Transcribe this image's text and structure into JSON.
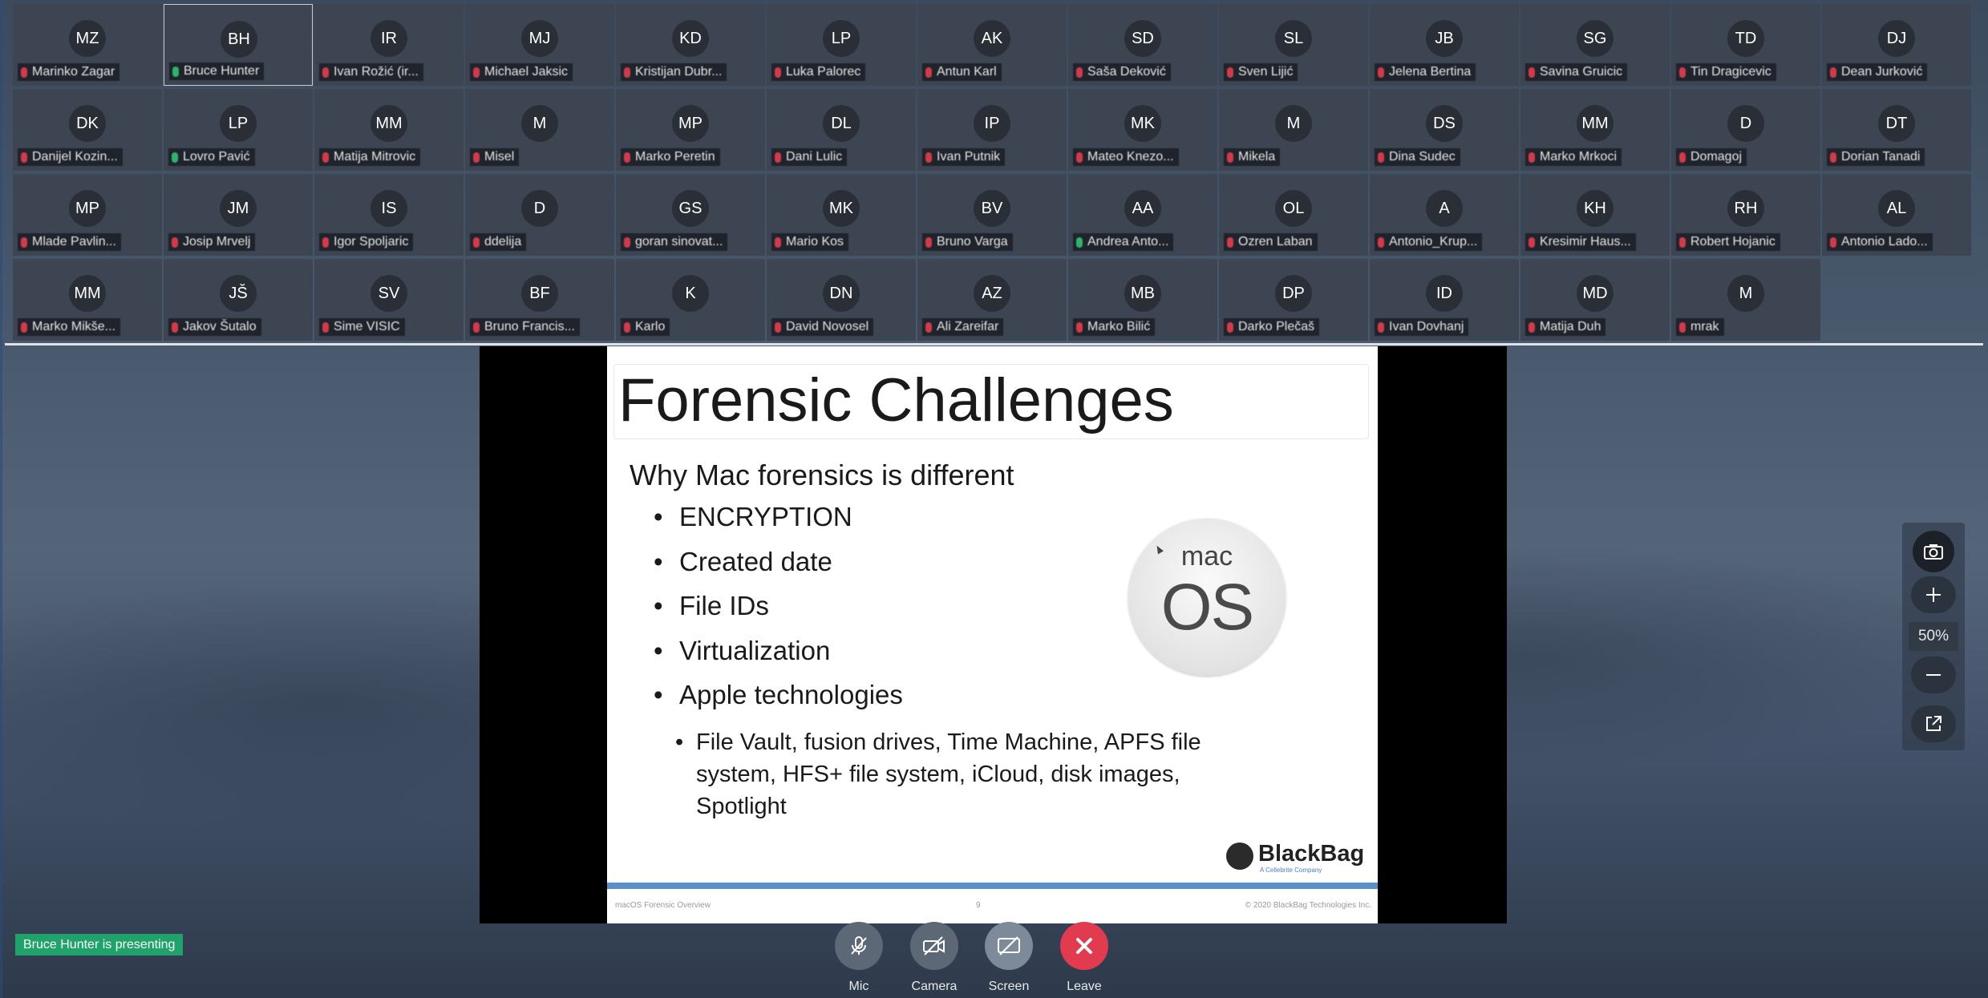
{
  "participants": [
    {
      "initials": "MZ",
      "name": "Marinko Zagar",
      "mic": "off"
    },
    {
      "initials": "BH",
      "name": "Bruce Hunter",
      "mic": "on",
      "active": true
    },
    {
      "initials": "IR",
      "name": "Ivan Rožić (ir...",
      "mic": "off"
    },
    {
      "initials": "MJ",
      "name": "Michael Jaksic",
      "mic": "off"
    },
    {
      "initials": "KD",
      "name": "Kristijan Dubr...",
      "mic": "off"
    },
    {
      "initials": "LP",
      "name": "Luka Palorec",
      "mic": "off"
    },
    {
      "initials": "AK",
      "name": "Antun Karl",
      "mic": "off"
    },
    {
      "initials": "SD",
      "name": "Saša Deković",
      "mic": "off"
    },
    {
      "initials": "SL",
      "name": "Sven Lijić",
      "mic": "off"
    },
    {
      "initials": "JB",
      "name": "Jelena Bertina",
      "mic": "off"
    },
    {
      "initials": "SG",
      "name": "Savina Gruicic",
      "mic": "off"
    },
    {
      "initials": "TD",
      "name": "Tin Dragicevic",
      "mic": "off"
    },
    {
      "initials": "DJ",
      "name": "Dean Jurković",
      "mic": "off"
    },
    {
      "initials": "DK",
      "name": "Danijel Kozin...",
      "mic": "off"
    },
    {
      "initials": "LP",
      "name": "Lovro Pavić",
      "mic": "on"
    },
    {
      "initials": "MM",
      "name": "Matija Mitrovic",
      "mic": "off"
    },
    {
      "initials": "M",
      "name": "Misel",
      "mic": "off"
    },
    {
      "initials": "MP",
      "name": "Marko Peretin",
      "mic": "off"
    },
    {
      "initials": "DL",
      "name": "Dani Lulic",
      "mic": "off"
    },
    {
      "initials": "IP",
      "name": "Ivan Putnik",
      "mic": "off"
    },
    {
      "initials": "MK",
      "name": "Mateo Knezo...",
      "mic": "off"
    },
    {
      "initials": "M",
      "name": "Mikela",
      "mic": "off"
    },
    {
      "initials": "DS",
      "name": "Dina Sudec",
      "mic": "off"
    },
    {
      "initials": "MM",
      "name": "Marko Mrkoci",
      "mic": "off"
    },
    {
      "initials": "D",
      "name": "Domagoj",
      "mic": "off"
    },
    {
      "initials": "DT",
      "name": "Dorian Tanadi",
      "mic": "off"
    },
    {
      "initials": "MP",
      "name": "Mlade Pavlin...",
      "mic": "off"
    },
    {
      "initials": "JM",
      "name": "Josip Mrvelj",
      "mic": "off"
    },
    {
      "initials": "IS",
      "name": "Igor Spoljaric",
      "mic": "off"
    },
    {
      "initials": "D",
      "name": "ddelija",
      "mic": "off"
    },
    {
      "initials": "GS",
      "name": "goran sinovat...",
      "mic": "off"
    },
    {
      "initials": "MK",
      "name": "Mario Kos",
      "mic": "off"
    },
    {
      "initials": "BV",
      "name": "Bruno Varga",
      "mic": "off"
    },
    {
      "initials": "AA",
      "name": "Andrea Anto...",
      "mic": "on"
    },
    {
      "initials": "OL",
      "name": "Ozren Laban",
      "mic": "off"
    },
    {
      "initials": "A",
      "name": "Antonio_Krup...",
      "mic": "off"
    },
    {
      "initials": "KH",
      "name": "Kresimir Haus...",
      "mic": "off"
    },
    {
      "initials": "RH",
      "name": "Robert Hojanic",
      "mic": "off"
    },
    {
      "initials": "AL",
      "name": "Antonio Lado...",
      "mic": "off"
    },
    {
      "initials": "MM",
      "name": "Marko Mikše...",
      "mic": "off"
    },
    {
      "initials": "JŠ",
      "name": "Jakov Šutalo",
      "mic": "off"
    },
    {
      "initials": "SV",
      "name": "Sime VISIC",
      "mic": "off"
    },
    {
      "initials": "BF",
      "name": "Bruno Francis...",
      "mic": "off"
    },
    {
      "initials": "K",
      "name": "Karlo",
      "mic": "off"
    },
    {
      "initials": "DN",
      "name": "David Novosel",
      "mic": "off"
    },
    {
      "initials": "AZ",
      "name": "Ali Zareifar",
      "mic": "off"
    },
    {
      "initials": "MB",
      "name": "Marko Bilić",
      "mic": "off"
    },
    {
      "initials": "DP",
      "name": "Darko Plečaš",
      "mic": "off"
    },
    {
      "initials": "ID",
      "name": "Ivan Dovhanj",
      "mic": "off"
    },
    {
      "initials": "MD",
      "name": "Matija Duh",
      "mic": "off"
    },
    {
      "initials": "M",
      "name": "mrak",
      "mic": "off"
    }
  ],
  "slide": {
    "title": "Forensic Challenges",
    "subtitle": "Why Mac forensics is different",
    "bullets": [
      "ENCRYPTION",
      "Created date",
      "File IDs",
      "Virtualization",
      "Apple technologies"
    ],
    "sub_bullet": "File Vault, fusion drives, Time Machine, APFS file system, HFS+ file system, iCloud, disk images, Spotlight",
    "logo_line1": "mac",
    "logo_line2": "OS",
    "brand": "BlackBag",
    "brand_tagline": "A Cellebrite Company",
    "footer_left": "macOS Forensic Overview",
    "footer_page": "9",
    "footer_right": "© 2020 BlackBag Technologies Inc."
  },
  "presenting_text": "Bruce Hunter is presenting",
  "controls": {
    "mic": "Mic",
    "camera": "Camera",
    "screen": "Screen",
    "leave": "Leave"
  },
  "zoom_level": "50%",
  "icons": [
    "mic-off-icon",
    "camera-off-icon",
    "screen-share-icon",
    "close-icon",
    "camera-snapshot-icon",
    "zoom-in-icon",
    "zoom-out-icon",
    "pop-out-icon"
  ],
  "colors": {
    "presenting_badge": "#1fa36a",
    "leave_button": "#e23a4e",
    "slide_accent": "#5a8fcb"
  }
}
